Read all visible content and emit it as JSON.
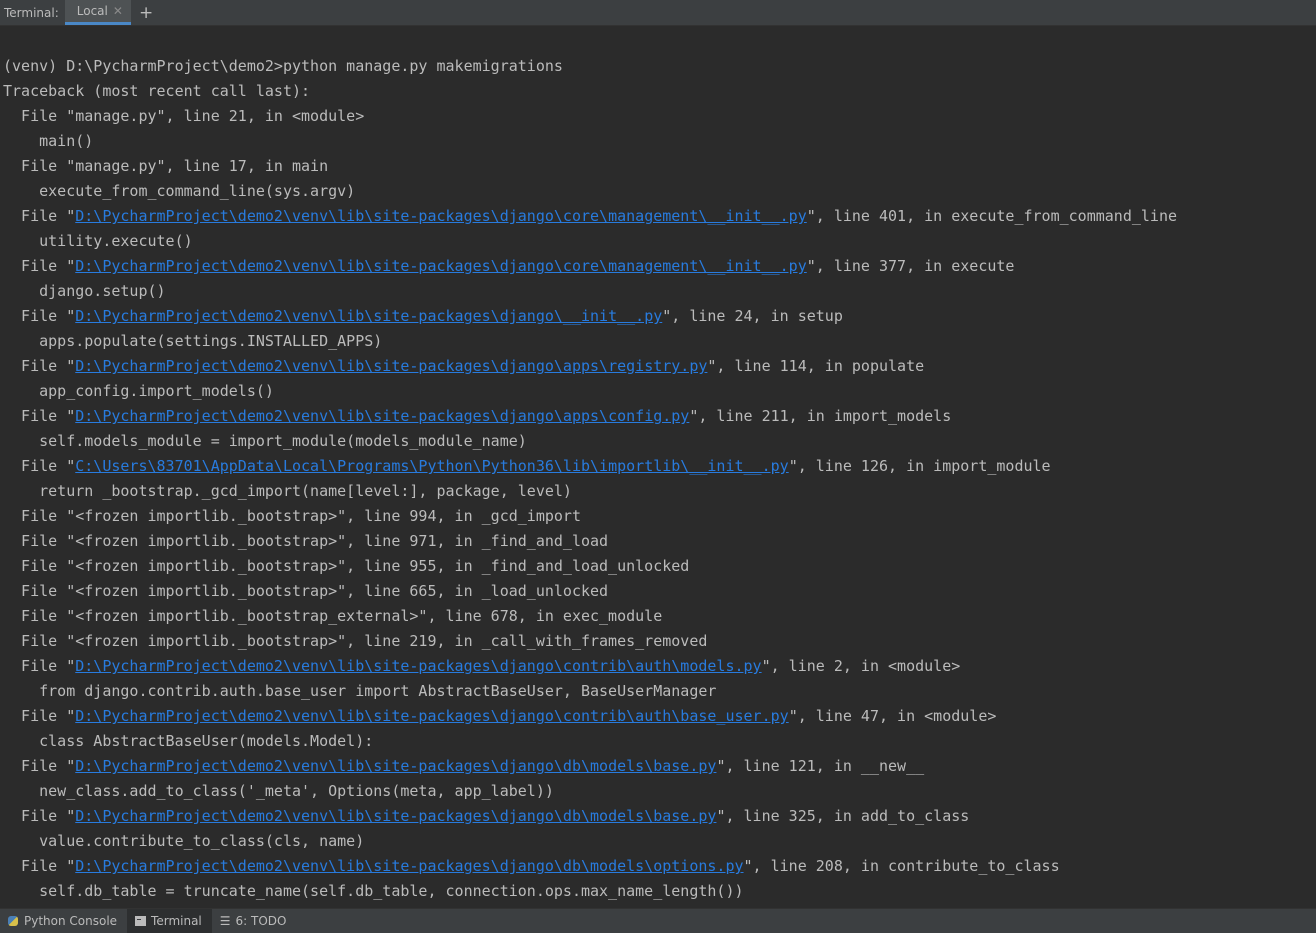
{
  "colors": {
    "background": "#2b2b2b",
    "text": "#bbbbbb",
    "link": "#287bde",
    "toolbar": "#3c3f41",
    "accent": "#4a88c7"
  },
  "tabbar": {
    "title": "Terminal:",
    "tabs": [
      {
        "label": "Local",
        "close_icon": "close-icon"
      }
    ],
    "add_icon": "+"
  },
  "terminal": {
    "lines": [
      [
        {
          "t": "(venv) D:\\PycharmProject\\demo2>python manage.py makemigrations"
        }
      ],
      [
        {
          "t": "Traceback (most recent call last):"
        }
      ],
      [
        {
          "t": "  File \"manage.py\", line 21, in <module>"
        }
      ],
      [
        {
          "t": "    main()"
        }
      ],
      [
        {
          "t": "  File \"manage.py\", line 17, in main"
        }
      ],
      [
        {
          "t": "    execute_from_command_line(sys.argv)"
        }
      ],
      [
        {
          "t": "  File \""
        },
        {
          "t": "D:\\PycharmProject\\demo2\\venv\\lib\\site-packages\\django\\core\\management\\__init__.py",
          "link": true
        },
        {
          "t": "\", line 401, in execute_from_command_line"
        }
      ],
      [
        {
          "t": "    utility.execute()"
        }
      ],
      [
        {
          "t": "  File \""
        },
        {
          "t": "D:\\PycharmProject\\demo2\\venv\\lib\\site-packages\\django\\core\\management\\__init__.py",
          "link": true
        },
        {
          "t": "\", line 377, in execute"
        }
      ],
      [
        {
          "t": "    django.setup()"
        }
      ],
      [
        {
          "t": "  File \""
        },
        {
          "t": "D:\\PycharmProject\\demo2\\venv\\lib\\site-packages\\django\\__init__.py",
          "link": true
        },
        {
          "t": "\", line 24, in setup"
        }
      ],
      [
        {
          "t": "    apps.populate(settings.INSTALLED_APPS)"
        }
      ],
      [
        {
          "t": "  File \""
        },
        {
          "t": "D:\\PycharmProject\\demo2\\venv\\lib\\site-packages\\django\\apps\\registry.py",
          "link": true
        },
        {
          "t": "\", line 114, in populate"
        }
      ],
      [
        {
          "t": "    app_config.import_models()"
        }
      ],
      [
        {
          "t": "  File \""
        },
        {
          "t": "D:\\PycharmProject\\demo2\\venv\\lib\\site-packages\\django\\apps\\config.py",
          "link": true
        },
        {
          "t": "\", line 211, in import_models"
        }
      ],
      [
        {
          "t": "    self.models_module = import_module(models_module_name)"
        }
      ],
      [
        {
          "t": "  File \""
        },
        {
          "t": "C:\\Users\\83701\\AppData\\Local\\Programs\\Python\\Python36\\lib\\importlib\\__init__.py",
          "link": true
        },
        {
          "t": "\", line 126, in import_module"
        }
      ],
      [
        {
          "t": "    return _bootstrap._gcd_import(name[level:], package, level)"
        }
      ],
      [
        {
          "t": "  File \"<frozen importlib._bootstrap>\", line 994, in _gcd_import"
        }
      ],
      [
        {
          "t": "  File \"<frozen importlib._bootstrap>\", line 971, in _find_and_load"
        }
      ],
      [
        {
          "t": "  File \"<frozen importlib._bootstrap>\", line 955, in _find_and_load_unlocked"
        }
      ],
      [
        {
          "t": "  File \"<frozen importlib._bootstrap>\", line 665, in _load_unlocked"
        }
      ],
      [
        {
          "t": "  File \"<frozen importlib._bootstrap_external>\", line 678, in exec_module"
        }
      ],
      [
        {
          "t": "  File \"<frozen importlib._bootstrap>\", line 219, in _call_with_frames_removed"
        }
      ],
      [
        {
          "t": "  File \""
        },
        {
          "t": "D:\\PycharmProject\\demo2\\venv\\lib\\site-packages\\django\\contrib\\auth\\models.py",
          "link": true
        },
        {
          "t": "\", line 2, in <module>"
        }
      ],
      [
        {
          "t": "    from django.contrib.auth.base_user import AbstractBaseUser, BaseUserManager"
        }
      ],
      [
        {
          "t": "  File \""
        },
        {
          "t": "D:\\PycharmProject\\demo2\\venv\\lib\\site-packages\\django\\contrib\\auth\\base_user.py",
          "link": true
        },
        {
          "t": "\", line 47, in <module>"
        }
      ],
      [
        {
          "t": "    class AbstractBaseUser(models.Model):"
        }
      ],
      [
        {
          "t": "  File \""
        },
        {
          "t": "D:\\PycharmProject\\demo2\\venv\\lib\\site-packages\\django\\db\\models\\base.py",
          "link": true
        },
        {
          "t": "\", line 121, in __new__"
        }
      ],
      [
        {
          "t": "    new_class.add_to_class('_meta', Options(meta, app_label))"
        }
      ],
      [
        {
          "t": "  File \""
        },
        {
          "t": "D:\\PycharmProject\\demo2\\venv\\lib\\site-packages\\django\\db\\models\\base.py",
          "link": true
        },
        {
          "t": "\", line 325, in add_to_class"
        }
      ],
      [
        {
          "t": "    value.contribute_to_class(cls, name)"
        }
      ],
      [
        {
          "t": "  File \""
        },
        {
          "t": "D:\\PycharmProject\\demo2\\venv\\lib\\site-packages\\django\\db\\models\\options.py",
          "link": true
        },
        {
          "t": "\", line 208, in contribute_to_class"
        }
      ],
      [
        {
          "t": "    self.db_table = truncate_name(self.db_table, connection.ops.max_name_length())"
        }
      ]
    ]
  },
  "bottombar": {
    "tools": [
      {
        "label": "Python Console",
        "icon": "python-icon"
      },
      {
        "label": "Terminal",
        "icon": "terminal-icon",
        "active": true
      },
      {
        "label": "6: TODO",
        "icon": "list-icon"
      }
    ]
  }
}
